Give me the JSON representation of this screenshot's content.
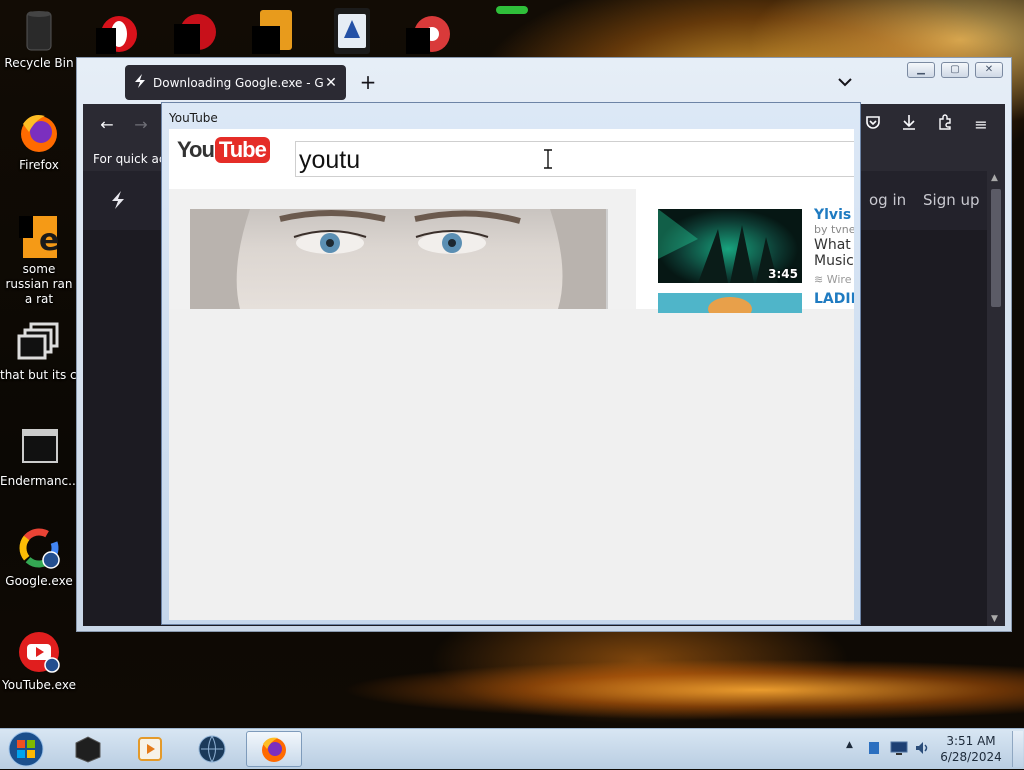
{
  "desktop": {
    "icons": [
      {
        "label": "Recycle Bin"
      },
      {
        "label": "Firefox"
      },
      {
        "label": "some russian ran a rat"
      },
      {
        "label": "that but its c#"
      },
      {
        "label": "Endermanc..."
      },
      {
        "label": "Google.exe"
      },
      {
        "label": "YouTube.exe"
      }
    ]
  },
  "firefox": {
    "tab_title": "Downloading Google.exe - Gam",
    "bookmarks_hint": "For quick acc",
    "site_nav": {
      "login": "og in",
      "signup": "Sign up"
    }
  },
  "youtube_window": {
    "title": "YouTube",
    "logo": {
      "you": "You",
      "tube": "Tube"
    },
    "search_value": "youtu",
    "video": {
      "title": "Ylvis -",
      "by": "by tvne",
      "desc_line1": "What",
      "desc_line2": "Music",
      "meta": "Wire",
      "duration": "3:45",
      "next_title": "LADIE"
    }
  },
  "taskbar": {
    "time": "3:51 AM",
    "date": "6/28/2024"
  },
  "colors": {
    "firefox_dark": "#2b2a33",
    "youtube_red": "#e52d27",
    "link_blue": "#1f7bc1",
    "taskbar": "#c8d9ea"
  }
}
